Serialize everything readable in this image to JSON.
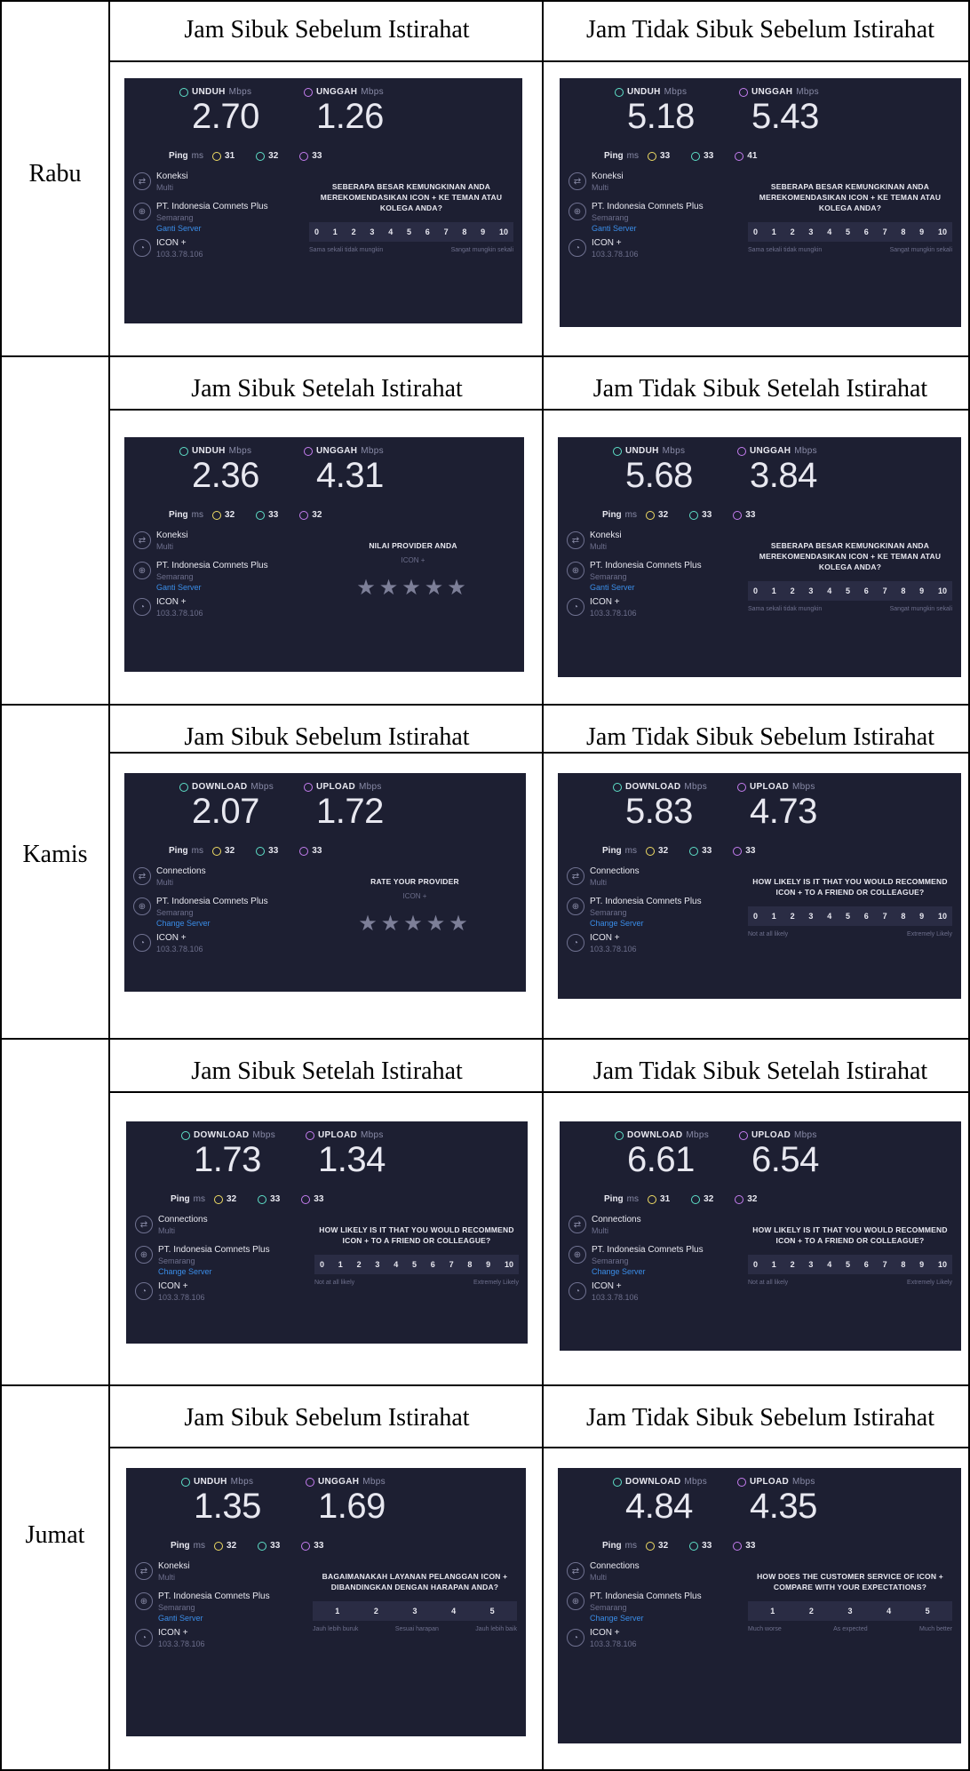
{
  "days": [
    "Rabu",
    "Kamis",
    "Jumat"
  ],
  "captions": [
    [
      "Jam Sibuk Sebelum Istirahat",
      "Jam Tidak Sibuk Sebelum Istirahat"
    ],
    [
      "Jam Sibuk Setelah Istirahat",
      "Jam Tidak Sibuk Setelah Istirahat"
    ],
    [
      "Jam Sibuk Sebelum Istirahat",
      "Jam Tidak Sibuk Sebelum Istirahat"
    ],
    [
      "Jam Sibuk Setelah Istirahat",
      "Jam Tidak Sibuk Setelah Istirahat"
    ],
    [
      "Jam Sibuk Sebelum Istirahat",
      "Jam Tidak Sibuk Sebelum Istirahat"
    ]
  ],
  "tests": [
    {
      "dl_label": "UNDUH",
      "ul_label": "UNGGAH",
      "unit": "Mbps",
      "dl": "2.70",
      "ul": "1.26",
      "ping_label": "Ping",
      "ping_unit": "ms",
      "p1": "31",
      "p2": "32",
      "p3": "33",
      "conn_label": "Koneksi",
      "conn_sub": "Multi",
      "isp": "PT. Indonesia Comnets Plus",
      "city": "Semarang",
      "change": "Ganti Server",
      "host": "ICON +",
      "ip": "103.3.78.106",
      "survey": "scale",
      "q": "SEBERAPA BESAR KEMUNGKINAN ANDA MEREKOMENDASIKAN ICON + KE TEMAN ATAU KOLEGA ANDA?",
      "scale_low": "Sama sekali tidak mungkin",
      "scale_high": "Sangat mungkin sekali"
    },
    {
      "dl_label": "UNDUH",
      "ul_label": "UNGGAH",
      "unit": "Mbps",
      "dl": "5.18",
      "ul": "5.43",
      "ping_label": "Ping",
      "ping_unit": "ms",
      "p1": "33",
      "p2": "33",
      "p3": "41",
      "conn_label": "Koneksi",
      "conn_sub": "Multi",
      "isp": "PT. Indonesia Comnets Plus",
      "city": "Semarang",
      "change": "Ganti Server",
      "host": "ICON +",
      "ip": "103.3.78.106",
      "survey": "scale",
      "q": "SEBERAPA BESAR KEMUNGKINAN ANDA MEREKOMENDASIKAN ICON + KE TEMAN ATAU KOLEGA ANDA?",
      "scale_low": "Sama sekali tidak mungkin",
      "scale_high": "Sangat mungkin sekali"
    },
    {
      "dl_label": "UNDUH",
      "ul_label": "UNGGAH",
      "unit": "Mbps",
      "dl": "2.36",
      "ul": "4.31",
      "ping_label": "Ping",
      "ping_unit": "ms",
      "p1": "32",
      "p2": "33",
      "p3": "32",
      "conn_label": "Koneksi",
      "conn_sub": "Multi",
      "isp": "PT. Indonesia Comnets Plus",
      "city": "Semarang",
      "change": "Ganti Server",
      "host": "ICON +",
      "ip": "103.3.78.106",
      "survey": "stars",
      "q": "NILAI PROVIDER ANDA",
      "sub": "ICON +"
    },
    {
      "dl_label": "UNDUH",
      "ul_label": "UNGGAH",
      "unit": "Mbps",
      "dl": "5.68",
      "ul": "3.84",
      "ping_label": "Ping",
      "ping_unit": "ms",
      "p1": "32",
      "p2": "33",
      "p3": "33",
      "conn_label": "Koneksi",
      "conn_sub": "Multi",
      "isp": "PT. Indonesia Comnets Plus",
      "city": "Semarang",
      "change": "Ganti Server",
      "host": "ICON +",
      "ip": "103.3.78.106",
      "survey": "scale",
      "q": "SEBERAPA BESAR KEMUNGKINAN ANDA MEREKOMENDASIKAN ICON + KE TEMAN ATAU KOLEGA ANDA?",
      "scale_low": "Sama sekali tidak mungkin",
      "scale_high": "Sangat mungkin sekali"
    },
    {
      "dl_label": "DOWNLOAD",
      "ul_label": "UPLOAD",
      "unit": "Mbps",
      "dl": "2.07",
      "ul": "1.72",
      "ping_label": "Ping",
      "ping_unit": "ms",
      "p1": "32",
      "p2": "33",
      "p3": "33",
      "conn_label": "Connections",
      "conn_sub": "Multi",
      "isp": "PT. Indonesia Comnets Plus",
      "city": "Semarang",
      "change": "Change Server",
      "host": "ICON +",
      "ip": "103.3.78.106",
      "survey": "stars",
      "q": "RATE YOUR PROVIDER",
      "sub": "ICON +"
    },
    {
      "dl_label": "DOWNLOAD",
      "ul_label": "UPLOAD",
      "unit": "Mbps",
      "dl": "5.83",
      "ul": "4.73",
      "ping_label": "Ping",
      "ping_unit": "ms",
      "p1": "32",
      "p2": "33",
      "p3": "33",
      "conn_label": "Connections",
      "conn_sub": "Multi",
      "isp": "PT. Indonesia Comnets Plus",
      "city": "Semarang",
      "change": "Change Server",
      "host": "ICON +",
      "ip": "103.3.78.106",
      "survey": "scale",
      "q": "HOW LIKELY IS IT THAT YOU WOULD RECOMMEND ICON + TO A FRIEND OR COLLEAGUE?",
      "scale_low": "Not at all likely",
      "scale_high": "Extremely Likely"
    },
    {
      "dl_label": "DOWNLOAD",
      "ul_label": "UPLOAD",
      "unit": "Mbps",
      "dl": "1.73",
      "ul": "1.34",
      "ping_label": "Ping",
      "ping_unit": "ms",
      "p1": "32",
      "p2": "33",
      "p3": "33",
      "conn_label": "Connections",
      "conn_sub": "Multi",
      "isp": "PT. Indonesia Comnets Plus",
      "city": "Semarang",
      "change": "Change Server",
      "host": "ICON +",
      "ip": "103.3.78.106",
      "survey": "scale",
      "q": "HOW LIKELY IS IT THAT YOU WOULD RECOMMEND ICON + TO A FRIEND OR COLLEAGUE?",
      "scale_low": "Not at all likely",
      "scale_high": "Extremely Likely"
    },
    {
      "dl_label": "DOWNLOAD",
      "ul_label": "UPLOAD",
      "unit": "Mbps",
      "dl": "6.61",
      "ul": "6.54",
      "ping_label": "Ping",
      "ping_unit": "ms",
      "p1": "31",
      "p2": "32",
      "p3": "32",
      "conn_label": "Connections",
      "conn_sub": "Multi",
      "isp": "PT. Indonesia Comnets Plus",
      "city": "Semarang",
      "change": "Change Server",
      "host": "ICON +",
      "ip": "103.3.78.106",
      "survey": "scale",
      "q": "HOW LIKELY IS IT THAT YOU WOULD RECOMMEND ICON + TO A FRIEND OR COLLEAGUE?",
      "scale_low": "Not at all likely",
      "scale_high": "Extremely Likely"
    },
    {
      "dl_label": "UNDUH",
      "ul_label": "UNGGAH",
      "unit": "Mbps",
      "dl": "1.35",
      "ul": "1.69",
      "ping_label": "Ping",
      "ping_unit": "ms",
      "p1": "32",
      "p2": "33",
      "p3": "33",
      "conn_label": "Koneksi",
      "conn_sub": "Multi",
      "isp": "PT. Indonesia Comnets Plus",
      "city": "Semarang",
      "change": "Ganti Server",
      "host": "ICON +",
      "ip": "103.3.78.106",
      "survey": "five",
      "q": "BAGAIMANAKAH LAYANAN PELANGGAN ICON + DIBANDINGKAN DENGAN HARAPAN ANDA?",
      "labels": [
        "Jauh lebih buruk",
        "Sesuai harapan",
        "Jauh lebih baik"
      ]
    },
    {
      "dl_label": "DOWNLOAD",
      "ul_label": "UPLOAD",
      "unit": "Mbps",
      "dl": "4.84",
      "ul": "4.35",
      "ping_label": "Ping",
      "ping_unit": "ms",
      "p1": "32",
      "p2": "33",
      "p3": "33",
      "conn_label": "Connections",
      "conn_sub": "Multi",
      "isp": "PT. Indonesia Comnets Plus",
      "city": "Semarang",
      "change": "Change Server",
      "host": "ICON +",
      "ip": "103.3.78.106",
      "survey": "five",
      "q": "HOW DOES THE CUSTOMER SERVICE OF ICON + COMPARE WITH YOUR EXPECTATIONS?",
      "labels": [
        "Much worse",
        "As expected",
        "Much better"
      ]
    }
  ],
  "icons": {
    "download": "download-icon",
    "upload": "upload-icon",
    "ping": "ping-icon",
    "connections": "connections-icon",
    "server": "server-icon",
    "user": "user-icon",
    "star": "star-icon"
  },
  "colors": {
    "card_bg": "#1d1f32",
    "download": "#5ee0c8",
    "upload": "#c57df0",
    "ping": "#f0dc64",
    "link": "#3a8de8"
  }
}
